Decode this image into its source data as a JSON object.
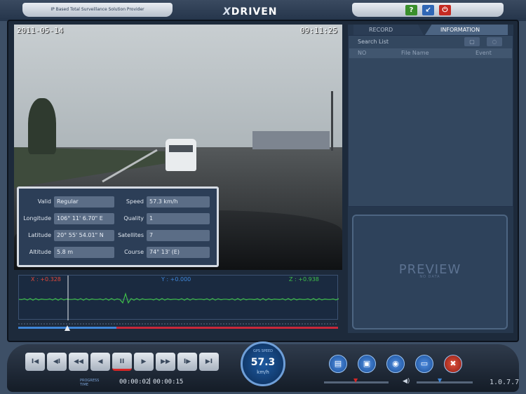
{
  "header": {
    "tagline": "IP Based Total Surveillance Solution Provider",
    "logo": "DRIVEN",
    "window_buttons": [
      {
        "icon": "help-icon",
        "label": "?",
        "color": "#3a8f2c"
      },
      {
        "icon": "minimize-icon",
        "label": "↙",
        "color": "#2f66b5"
      },
      {
        "icon": "power-icon",
        "label": "⏻",
        "color": "#c52a22"
      }
    ]
  },
  "video": {
    "date": "2011-05-14",
    "time": "09:11:25"
  },
  "gps": {
    "valid_label": "Valid",
    "valid_value": "Regular",
    "longitude_label": "Longitude",
    "longitude_value": "106° 11' 6.70\" E",
    "latitude_label": "Latitude",
    "latitude_value": "20° 55' 54.01\" N",
    "altitude_label": "Altitude",
    "altitude_value": "5.8 m",
    "speed_label": "Speed",
    "speed_value": "57.3 km/h",
    "quality_label": "Quality",
    "quality_value": "1",
    "satellites_label": "Satellites",
    "satellites_value": "7",
    "course_label": "Course",
    "course_value": "74° 13' (E)"
  },
  "right_panel": {
    "tab_record": "RECORD",
    "tab_information": "INFORMATION",
    "search_label": "Search List",
    "columns": [
      "NO",
      "File Name",
      "Event"
    ],
    "preview_text": "PREVIEW",
    "preview_sub": "NO DATA"
  },
  "graph": {
    "x_label": "X : +0.328",
    "y_label": "Y : +0.000",
    "z_label": "Z : +0.938",
    "colors": {
      "x": "#e0483a",
      "y": "#3f86d8",
      "z": "#3fbf4a",
      "trace": "#3fbf4a"
    }
  },
  "controls": {
    "buttons": [
      {
        "name": "go-start-button",
        "label": "I◀"
      },
      {
        "name": "step-back-button",
        "label": "◀I"
      },
      {
        "name": "rewind-button",
        "label": "◀◀"
      },
      {
        "name": "reverse-play-button",
        "label": "◀"
      },
      {
        "name": "pause-button",
        "label": "II"
      },
      {
        "name": "play-button",
        "label": "▶"
      },
      {
        "name": "fast-forward-button",
        "label": "▶▶"
      },
      {
        "name": "step-forward-button",
        "label": "I▶"
      },
      {
        "name": "go-end-button",
        "label": "▶I"
      }
    ],
    "speed_label": "GPS SPEED",
    "speed_value": "57.3",
    "speed_unit": "km/h",
    "progress_label": "PROGRESS TIME",
    "time_current": "00:00:02",
    "time_total": "00:00:15",
    "version": "1.0.7.7",
    "round_buttons": [
      {
        "name": "open-folder-button",
        "icon": "book-icon",
        "label": "▤"
      },
      {
        "name": "save-button",
        "icon": "floppy-icon",
        "label": "▣"
      },
      {
        "name": "snapshot-button",
        "icon": "camera-icon",
        "label": "◉"
      },
      {
        "name": "print-button",
        "icon": "printer-icon",
        "label": "▭"
      },
      {
        "name": "settings-button",
        "icon": "tools-icon",
        "label": "✖"
      }
    ]
  }
}
